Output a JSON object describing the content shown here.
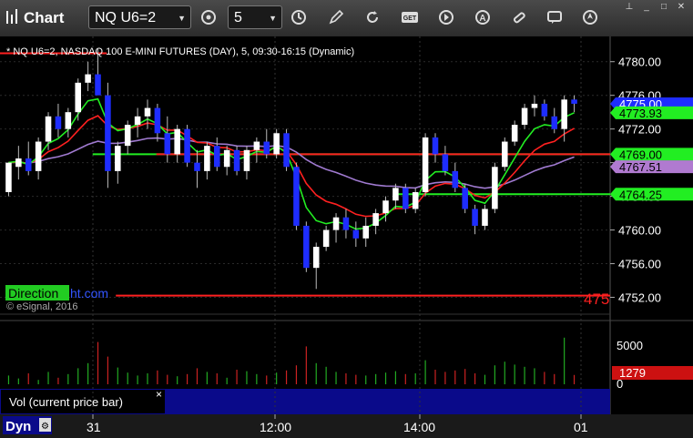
{
  "window": {
    "title": "Chart"
  },
  "toolbar": {
    "symbol": "NQ U6=2",
    "interval": "5",
    "buttons": [
      "target-icon",
      "clock-icon",
      "pencil-icon",
      "refresh-icon",
      "get-icon",
      "play-icon",
      "alert-icon",
      "link-icon",
      "comment-icon",
      "nav-icon"
    ]
  },
  "chart_header": "* NQ U6=2, NASDAQ 100 E-MINI FUTURES (DAY), 5, 09:30-16:15 (Dynamic)",
  "watermark": {
    "brand_a": "Direction",
    "brand_b": "ht.com",
    "copyright": "© eSignal, 2016"
  },
  "price_axis": {
    "ticks": [
      "4780.00",
      "4776.00",
      "4772.00",
      "4768.00",
      "4764.00",
      "4760.00",
      "4756.00",
      "4752.00"
    ]
  },
  "price_tags": [
    {
      "text": "4775.00",
      "price": 4775.0,
      "bg": "#1e2dff",
      "fg": "#ffffff"
    },
    {
      "text": "4773.93",
      "price": 4773.93,
      "bg": "#22ee22",
      "fg": "#000000"
    },
    {
      "text": "4769.00",
      "price": 4769.0,
      "bg": "#22ee22",
      "fg": "#000000"
    },
    {
      "text": "4767.51",
      "price": 4767.51,
      "bg": "#b07ad0",
      "fg": "#000000"
    },
    {
      "text": "4764.25",
      "price": 4764.25,
      "bg": "#22ee22",
      "fg": "#000000"
    }
  ],
  "support_label": "475",
  "volume_panel": {
    "axis_ticks": [
      "5000",
      "0"
    ],
    "current_tag": "1279",
    "legend": "Vol (current price bar)",
    "close_glyph": "×"
  },
  "time_axis": {
    "labels": [
      "31",
      "12:00",
      "14:00",
      "01"
    ],
    "dyn_label": "Dyn"
  },
  "colors": {
    "up": "#ffffff",
    "down": "#1e2dff",
    "green_ma": "#22ee22",
    "red_ma": "#ff2020",
    "purple_ma": "#a07ad0",
    "vol_up": "#22aa22",
    "vol_down": "#cc2222"
  },
  "chart_data": {
    "type": "candlestick",
    "ylim": [
      4750,
      4783
    ],
    "levels": [
      {
        "price": 4781.0,
        "color": "#ff2020",
        "xrange": [
          0,
          0.175
        ]
      },
      {
        "price": 4769.0,
        "color": "#22ee22",
        "xrange": [
          0.16,
          1.0
        ]
      },
      {
        "price": 4769.0,
        "color": "#ff2020",
        "xrange": [
          0.27,
          1.0
        ]
      },
      {
        "price": 4764.25,
        "color": "#22ee22",
        "xrange": [
          0.68,
          1.0
        ]
      },
      {
        "price": 4752.2,
        "color": "#ff2020",
        "xrange": [
          0.2,
          1.0
        ]
      }
    ],
    "candles": [
      [
        4764.5,
        4768.0,
        4764.0,
        4768.0
      ],
      [
        4767.5,
        4770.0,
        4766.0,
        4768.5
      ],
      [
        4768.5,
        4770.5,
        4766.5,
        4767.0
      ],
      [
        4767.0,
        4771.0,
        4766.0,
        4770.5
      ],
      [
        4770.5,
        4774.0,
        4769.5,
        4773.5
      ],
      [
        4773.5,
        4775.0,
        4771.0,
        4772.0
      ],
      [
        4772.0,
        4774.5,
        4771.0,
        4774.0
      ],
      [
        4774.0,
        4778.0,
        4773.0,
        4777.5
      ],
      [
        4777.5,
        4780.0,
        4776.5,
        4778.5
      ],
      [
        4778.5,
        4781.5,
        4777.0,
        4776.0
      ],
      [
        4776.0,
        4777.5,
        4765.0,
        4767.0
      ],
      [
        4767.0,
        4770.5,
        4765.5,
        4770.0
      ],
      [
        4770.0,
        4773.0,
        4769.0,
        4772.5
      ],
      [
        4772.5,
        4774.5,
        4771.0,
        4773.5
      ],
      [
        4773.5,
        4775.5,
        4772.0,
        4774.5
      ],
      [
        4774.5,
        4775.0,
        4770.5,
        4771.5
      ],
      [
        4771.5,
        4773.5,
        4768.0,
        4769.0
      ],
      [
        4769.0,
        4772.5,
        4768.0,
        4772.0
      ],
      [
        4772.0,
        4772.5,
        4767.5,
        4768.0
      ],
      [
        4768.0,
        4769.5,
        4765.0,
        4767.0
      ],
      [
        4767.0,
        4770.5,
        4766.0,
        4770.0
      ],
      [
        4770.0,
        4771.0,
        4767.0,
        4767.5
      ],
      [
        4767.5,
        4770.0,
        4766.5,
        4769.5
      ],
      [
        4769.5,
        4770.0,
        4766.5,
        4767.0
      ],
      [
        4767.0,
        4770.0,
        4766.0,
        4769.5
      ],
      [
        4769.5,
        4771.0,
        4768.0,
        4770.5
      ],
      [
        4770.5,
        4772.0,
        4768.5,
        4769.0
      ],
      [
        4769.0,
        4772.0,
        4768.5,
        4771.5
      ],
      [
        4771.5,
        4772.0,
        4767.0,
        4767.5
      ],
      [
        4767.5,
        4768.0,
        4760.0,
        4760.5
      ],
      [
        4760.5,
        4761.0,
        4755.0,
        4755.5
      ],
      [
        4755.5,
        4758.5,
        4753.0,
        4758.0
      ],
      [
        4758.0,
        4760.5,
        4757.5,
        4760.0
      ],
      [
        4760.0,
        4762.0,
        4758.5,
        4761.5
      ],
      [
        4761.5,
        4762.5,
        4759.0,
        4760.0
      ],
      [
        4760.0,
        4761.0,
        4758.0,
        4759.0
      ],
      [
        4759.0,
        4761.5,
        4758.0,
        4760.5
      ],
      [
        4760.5,
        4762.5,
        4759.5,
        4762.0
      ],
      [
        4762.0,
        4764.0,
        4761.0,
        4763.5
      ],
      [
        4763.5,
        4765.5,
        4762.5,
        4765.0
      ],
      [
        4765.0,
        4765.5,
        4762.0,
        4762.5
      ],
      [
        4762.5,
        4765.0,
        4762.0,
        4764.5
      ],
      [
        4764.5,
        4771.5,
        4764.0,
        4771.0
      ],
      [
        4771.0,
        4771.5,
        4768.0,
        4769.0
      ],
      [
        4769.0,
        4770.0,
        4766.5,
        4767.0
      ],
      [
        4767.0,
        4768.0,
        4764.5,
        4765.0
      ],
      [
        4765.0,
        4765.5,
        4762.0,
        4762.5
      ],
      [
        4762.5,
        4763.0,
        4759.5,
        4760.5
      ],
      [
        4760.5,
        4763.0,
        4760.0,
        4762.5
      ],
      [
        4762.5,
        4768.0,
        4762.0,
        4767.5
      ],
      [
        4767.5,
        4771.0,
        4767.0,
        4770.5
      ],
      [
        4770.5,
        4773.0,
        4770.0,
        4772.5
      ],
      [
        4772.5,
        4775.0,
        4772.0,
        4774.5
      ],
      [
        4774.5,
        4776.0,
        4773.5,
        4775.0
      ],
      [
        4775.0,
        4775.5,
        4773.0,
        4773.5
      ],
      [
        4773.5,
        4774.5,
        4771.5,
        4772.0
      ],
      [
        4772.0,
        4776.0,
        4770.5,
        4775.5
      ],
      [
        4775.5,
        4776.0,
        4774.0,
        4775.0
      ]
    ],
    "volume_ylim": [
      0,
      8000
    ],
    "volumes": [
      1200,
      800,
      1500,
      600,
      1700,
      900,
      1400,
      2200,
      2900,
      5800,
      3800,
      2300,
      1600,
      1200,
      1500,
      1900,
      1300,
      1100,
      1400,
      2200,
      1700,
      1500,
      900,
      2000,
      1800,
      1400,
      1200,
      1600,
      1900,
      2600,
      5200,
      2900,
      2400,
      1700,
      1500,
      1300,
      1200,
      1400,
      1600,
      1800,
      1400,
      1500,
      3300,
      2000,
      1700,
      1900,
      2100,
      1500,
      1300,
      2600,
      3100,
      2700,
      2400,
      2200,
      1700,
      1400,
      6400,
      1279
    ]
  }
}
